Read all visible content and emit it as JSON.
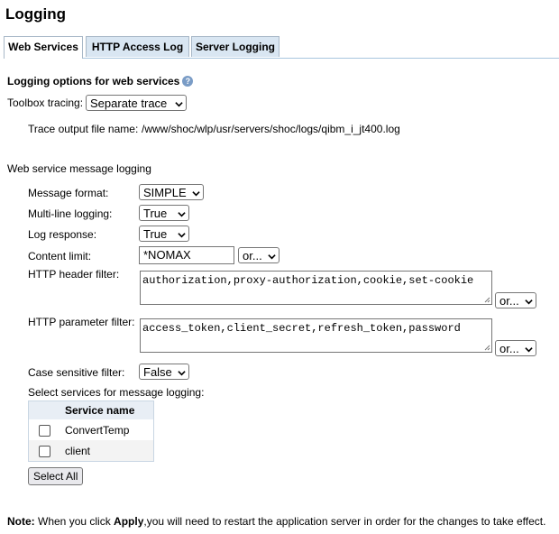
{
  "page": {
    "title": "Logging"
  },
  "tabs": [
    {
      "label": "Web Services"
    },
    {
      "label": "HTTP Access Log"
    },
    {
      "label": "Server Logging"
    }
  ],
  "options": {
    "heading": "Logging options for web services",
    "help_icon": "question-circle",
    "toolbox_label": "Toolbox tracing:",
    "toolbox_value": "Separate trace",
    "trace_label": "Trace output file name:",
    "trace_value": "/www/shoc/wlp/usr/servers/shoc/logs/qibm_i_jt400.log"
  },
  "message_logging": {
    "heading": "Web service message logging",
    "format_label": "Message format:",
    "format_value": "SIMPLE",
    "multiline_label": "Multi-line logging:",
    "multiline_value": "True",
    "response_label": "Log response:",
    "response_value": "True",
    "content_label": "Content limit:",
    "content_value": "*NOMAX",
    "content_or": "or...",
    "header_label": "HTTP header filter:",
    "header_value": "authorization,proxy-authorization,cookie,set-cookie",
    "header_or": "or...",
    "param_label": "HTTP parameter filter:",
    "param_value": "access_token,client_secret,refresh_token,password",
    "param_or": "or...",
    "case_label": "Case sensitive filter:",
    "case_value": "False",
    "services_label": "Select services for message logging:"
  },
  "services": {
    "column": "Service name",
    "rows": [
      {
        "name": "ConvertTemp",
        "checked": false
      },
      {
        "name": "client",
        "checked": false
      }
    ]
  },
  "select_all": "Select All",
  "note": {
    "label": "Note:",
    "pre": " When you click ",
    "apply": "Apply",
    "post": ",you will need to restart the application server in order for the changes to take effect."
  },
  "colors": {
    "tab_bg": "#d9e6f2",
    "tab_border": "#a9c6de",
    "table_header": "#e8eef5"
  }
}
